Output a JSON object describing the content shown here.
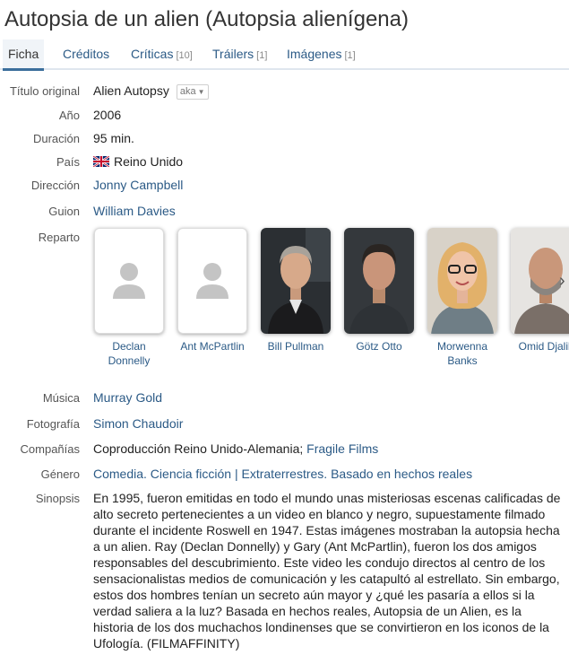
{
  "title": "Autopsia de un alien (Autopsia alienígena)",
  "tabs": [
    {
      "label": "Ficha",
      "count": ""
    },
    {
      "label": "Créditos",
      "count": ""
    },
    {
      "label": "Críticas",
      "count": "[10]"
    },
    {
      "label": "Tráilers",
      "count": "[1]"
    },
    {
      "label": "Imágenes",
      "count": "[1]"
    }
  ],
  "labels": {
    "original_title": "Título original",
    "year": "Año",
    "duration": "Duración",
    "country": "País",
    "direction": "Dirección",
    "script": "Guion",
    "cast": "Reparto",
    "music": "Música",
    "photography": "Fotografía",
    "companies": "Compañías",
    "genre": "Género",
    "synopsis": "Sinopsis"
  },
  "film": {
    "original_title": "Alien Autopsy",
    "aka_label": "aka",
    "year": "2006",
    "duration": "95 min.",
    "country": "Reino Unido",
    "direction": "Jonny Campbell",
    "script": "William Davies",
    "music": "Murray Gold",
    "photography": "Simon Chaudoir",
    "companies_text": "Coproducción Reino Unido-Alemania;",
    "companies_link": "Fragile Films",
    "genre_1": "Comedia. Ciencia ficción",
    "genre_sep": "|",
    "genre_2": "Extraterrestres. Basado en hechos reales",
    "synopsis": "En 1995, fueron emitidas en todo el mundo unas misteriosas escenas calificadas de alto secreto pertenecientes a un video en blanco y negro, supuestamente filmado durante el incidente Roswell en 1947. Estas imágenes mostraban la autopsia hecha a un alien. Ray (Declan Donnelly) y Gary (Ant McPartlin), fueron los dos amigos responsables del descubrimiento. Este video les condujo directos al centro de los sensacionalistas medios de comunicación y les catapultó al estrellato. Sin embargo, estos dos hombres tenían un secreto aún mayor y ¿qué les pasaría a ellos si la verdad saliera a la luz? Basada en hechos reales, Autopsia de un Alien, es la historia de los dos muchachos londinenses que se convirtieron en los iconos de la Ufología. (FILMAFFINITY)"
  },
  "cast": [
    {
      "name": "Declan Donnelly",
      "photo": "placeholder"
    },
    {
      "name": "Ant McPartlin",
      "photo": "placeholder"
    },
    {
      "name": "Bill Pullman",
      "photo": "portrait"
    },
    {
      "name": "Götz Otto",
      "photo": "portrait"
    },
    {
      "name": "Morwenna Banks",
      "photo": "portrait"
    },
    {
      "name": "Omid Djalili",
      "photo": "portrait"
    }
  ],
  "icons": {
    "flag": "uk-flag-icon",
    "next": "chevron-right-icon",
    "placeholder": "person-placeholder-icon"
  },
  "colors": {
    "link": "#2b5a86",
    "tab_underline": "#3b6e9c",
    "label": "#555555"
  }
}
